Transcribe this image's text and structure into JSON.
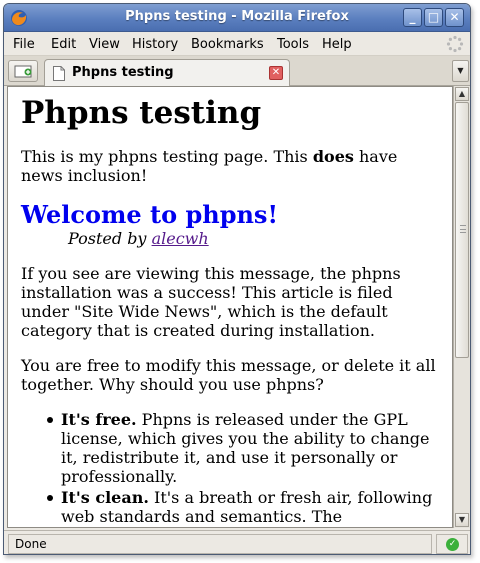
{
  "window": {
    "title": "Phpns testing - Mozilla Firefox",
    "controls": {
      "minimize": "_",
      "maximize": "□",
      "close": "✕"
    }
  },
  "menu": [
    "File",
    "Edit",
    "View",
    "History",
    "Bookmarks",
    "Tools",
    "Help"
  ],
  "tabs": [
    {
      "label": "Phpns testing",
      "active": true
    }
  ],
  "page": {
    "heading": "Phpns testing",
    "intro_before": "This is my phpns testing page. This ",
    "intro_bold": "does",
    "intro_after": " have news inclusion!",
    "article": {
      "title": "Welcome to phpns!",
      "posted_by_label": "Posted by ",
      "author": "alecwh",
      "paragraph1": "If you see are viewing this message, the phpns installation was a success! This article is filed under \"Site Wide News\", which is the default category that is created during installation.",
      "paragraph2": "You are free to modify this message, or delete it all together. Why should you use phpns?",
      "features": [
        {
          "bold": "It's free.",
          "text": " Phpns is released under the GPL license, which gives you the ability to change it, redistribute it, and use it personally or professionally."
        },
        {
          "bold": "It's clean.",
          "text": " It's a breath or fresh air, following web standards and semantics. The"
        }
      ]
    }
  },
  "status": {
    "text": "Done",
    "icon": "check-icon"
  },
  "colors": {
    "link": "#0000ee",
    "visited_link": "#551a8b",
    "titlebar": "#5b7fbf"
  }
}
